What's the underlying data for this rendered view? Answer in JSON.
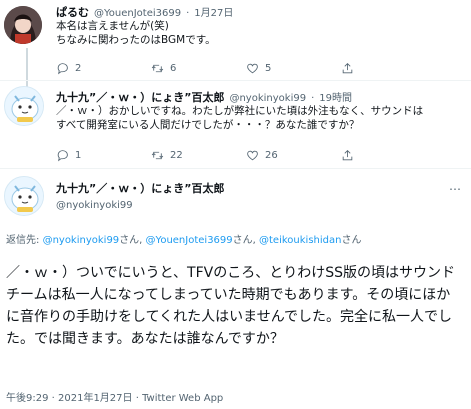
{
  "tweet1": {
    "name": "ぱるむ",
    "handle": "@YouenJotei3699",
    "sep": "·",
    "date": "1月27日",
    "lines": [
      "本名は言えませんが(笑)",
      "ちなみに関わったのはBGMです。"
    ],
    "counts": {
      "reply": "2",
      "retweet": "6",
      "like": "5"
    }
  },
  "tweet2": {
    "name": "九十九”／・ｗ・）にょき”百太郎",
    "handle": "@nyokinyoki99",
    "sep": "·",
    "time": "19時間",
    "lines": [
      "／・ｗ・）おかしいですね。わたしが弊社にいた頃は外注もなく、サウンドはすべて開発室にいる人間だけでしたが・・・？あなた誰ですか？"
    ],
    "counts": {
      "reply": "1",
      "retweet": "22",
      "like": "26"
    }
  },
  "tweet3": {
    "name": "九十九”／・ｗ・）にょき”百太郎",
    "handle": "@nyokinyoki99",
    "reply_to_label": "返信先:",
    "reply_to": [
      {
        "handle": "@nyokinyoki99",
        "suffix": "さん, "
      },
      {
        "handle": "@YouenJotei3699",
        "suffix": "さん, "
      },
      {
        "handle": "@teikoukishidan",
        "suffix": "さん"
      }
    ],
    "main_text": "／・ｗ・）ついでにいうと、TFVのころ、とりわけSS版の頃はサウンドチームは私一人になってしまっていた時期でもあります。その頃にほかに音作りの手助けをしてくれた人はいませんでした。完全に私一人でした。では聞きます。あなたは誰なんですか？",
    "footer": "午後9:29 · 2021年1月27日 · Twitter Web App"
  },
  "colors": {
    "link": "#1d9bf0",
    "meta": "#536471",
    "avatar_bg": "#e9f6ff"
  },
  "icons": [
    "reply-icon",
    "retweet-icon",
    "like-icon",
    "share-icon",
    "more-icon"
  ]
}
